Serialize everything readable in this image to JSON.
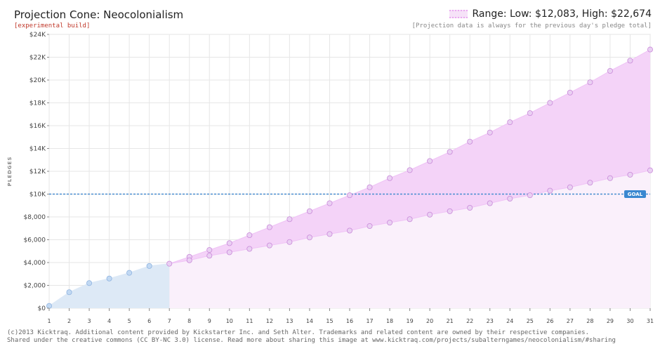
{
  "header": {
    "title": "Projection Cone: Neocolonialism",
    "subtitle": "[experimental build]",
    "range_label": "Range: Low: $12,083, High: $22,674",
    "note": "[Projection data is always for the previous day's pledge total]"
  },
  "footer": {
    "line1": "(c)2013 Kicktraq. Additional content provided by Kickstarter Inc. and Seth Alter. Trademarks and related content are owned by their respective companies.",
    "line2": "Shared under the creative commons (CC BY-NC 3.0) license. Read more about sharing this image at www.kicktraq.com/projects/subalterngames/neocolonialism/#sharing"
  },
  "chart_data": {
    "type": "area",
    "ylabel": "PLEDGES",
    "ylim": [
      0,
      24000
    ],
    "y_ticks": [
      0,
      2000,
      4000,
      6000,
      8000,
      10000,
      12000,
      14000,
      16000,
      18000,
      20000,
      22000,
      24000
    ],
    "y_tick_labels": [
      "$0",
      "$2,000",
      "$4,000",
      "$6,000",
      "$8,000",
      "$10K",
      "$12K",
      "$14K",
      "$16K",
      "$18K",
      "$20K",
      "$22K",
      "$24K"
    ],
    "x": [
      1,
      2,
      3,
      4,
      5,
      6,
      7,
      8,
      9,
      10,
      11,
      12,
      13,
      14,
      15,
      16,
      17,
      18,
      19,
      20,
      21,
      22,
      23,
      24,
      25,
      26,
      27,
      28,
      29,
      30,
      31
    ],
    "goal": 10000,
    "goal_label": "GOAL",
    "grid": true,
    "series": [
      {
        "x": [
          1,
          2,
          3,
          4,
          5,
          6,
          7
        ],
        "values": [
          200,
          1400,
          2200,
          2600,
          3100,
          3700,
          3900
        ],
        "color": "#a9c7ec"
      },
      {
        "x": [
          7,
          8,
          9,
          10,
          11,
          12,
          13,
          14,
          15,
          16,
          17,
          18,
          19,
          20,
          21,
          22,
          23,
          24,
          25,
          26,
          27,
          28,
          29,
          30,
          31
        ],
        "values": [
          3900,
          4500,
          5100,
          5700,
          6400,
          7100,
          7800,
          8500,
          9200,
          9900,
          10600,
          11400,
          12100,
          12900,
          13700,
          14600,
          15400,
          16300,
          17100,
          18000,
          18900,
          19800,
          20800,
          21700,
          22674
        ],
        "color": "#e2a7ee"
      },
      {
        "x": [
          7,
          8,
          9,
          10,
          11,
          12,
          13,
          14,
          15,
          16,
          17,
          18,
          19,
          20,
          21,
          22,
          23,
          24,
          25,
          26,
          27,
          28,
          29,
          30,
          31
        ],
        "values": [
          3900,
          4200,
          4600,
          4900,
          5200,
          5500,
          5800,
          6200,
          6500,
          6800,
          7200,
          7500,
          7800,
          8200,
          8500,
          8800,
          9200,
          9600,
          9900,
          10300,
          10600,
          11000,
          11400,
          11700,
          12083
        ],
        "color": "#e2a7ee"
      }
    ]
  },
  "colors": {
    "actual_fill": "#dde9f6",
    "actual_point": "#c2d9f3",
    "actual_stroke": "#8fb3e0",
    "cone_fill": "#f4d3f8",
    "cone_low_fill": "#faf0fb",
    "proj_point": "#ead0f3",
    "proj_stroke": "#c98ad9",
    "goal_line": "#4a8ed0",
    "goal_badge": "#3a87d0",
    "grid": "#e6e6e6"
  }
}
